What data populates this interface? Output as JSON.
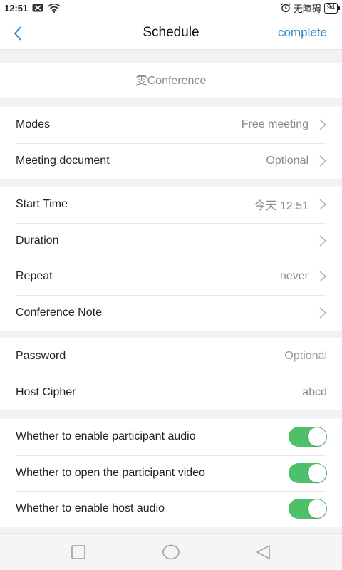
{
  "status_bar": {
    "time": "12:51",
    "carrier_text": "无障碍",
    "battery": "94",
    "icons": [
      "notification-icon",
      "wifi-icon",
      "alarm-icon"
    ]
  },
  "header": {
    "title": "Schedule",
    "back_icon": "chevron-left-icon",
    "complete_label": "complete"
  },
  "topic": {
    "placeholder": "雯Conference"
  },
  "section1": {
    "modes": {
      "label": "Modes",
      "value": "Free meeting"
    },
    "document": {
      "label": "Meeting document",
      "value": "Optional"
    }
  },
  "section2": {
    "start_time": {
      "label": "Start Time",
      "value": "今天 12:51"
    },
    "duration": {
      "label": "Duration",
      "value": ""
    },
    "repeat": {
      "label": "Repeat",
      "value": "never"
    },
    "note": {
      "label": "Conference Note",
      "value": ""
    }
  },
  "section3": {
    "password": {
      "label": "Password",
      "placeholder": "Optional"
    },
    "host_cipher": {
      "label": "Host Cipher",
      "value": "abcd"
    }
  },
  "section4": {
    "participant_audio": {
      "label": "Whether to enable participant audio",
      "enabled": true
    },
    "participant_video": {
      "label": "Whether to open the participant video",
      "enabled": true
    },
    "host_audio": {
      "label": "Whether to enable host audio",
      "enabled": true
    }
  },
  "colors": {
    "accent": "#2f86c6",
    "toggle_on": "#4fc06a",
    "background": "#f2f2f2"
  },
  "nav_bar": {
    "icons": [
      "square-icon",
      "circle-icon",
      "triangle-back-icon"
    ]
  }
}
